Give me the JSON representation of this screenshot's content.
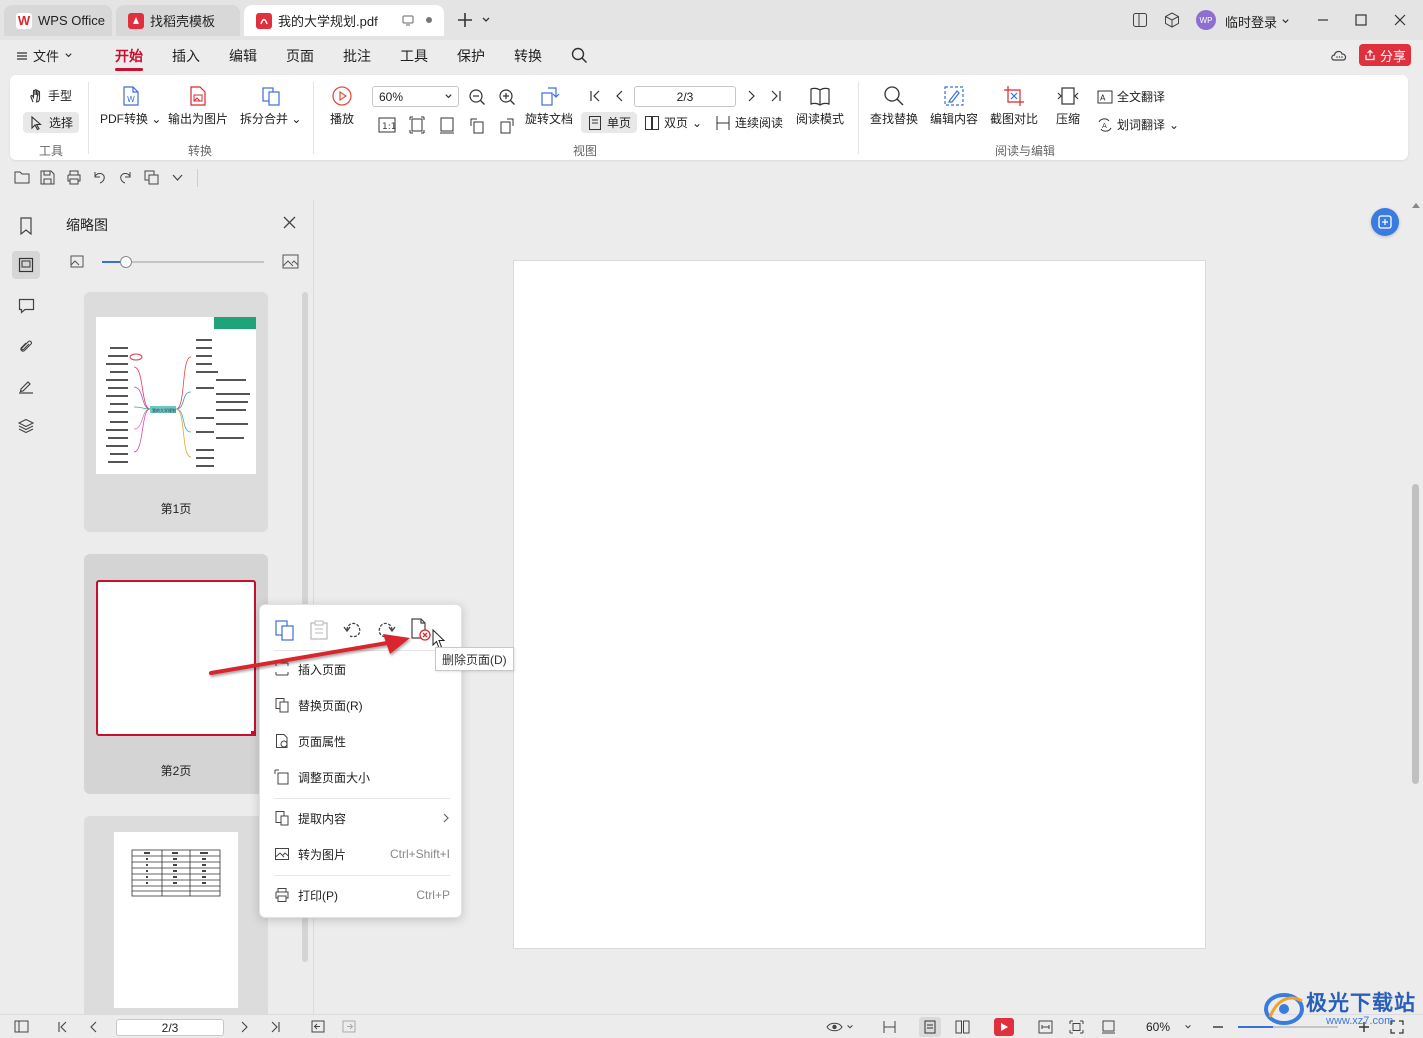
{
  "tabs": [
    {
      "label": "WPS Office"
    },
    {
      "label": "找稻壳模板"
    },
    {
      "label": "我的大学规划.pdf"
    }
  ],
  "titlebar": {
    "user_label": "临时登录",
    "avatar_text": "WP"
  },
  "menu": {
    "file_label": "文件",
    "items": [
      "开始",
      "插入",
      "编辑",
      "页面",
      "批注",
      "工具",
      "保护",
      "转换"
    ],
    "active": "开始",
    "share_label": "分享"
  },
  "ribbon": {
    "tools": {
      "hand": "手型",
      "select": "选择",
      "group": "工具"
    },
    "convert": {
      "pdf_convert": "PDF转换",
      "export_image": "输出为图片",
      "split_merge": "拆分合并",
      "group": "转换"
    },
    "view": {
      "play": "播放",
      "zoom": "60%",
      "page_input": "2/3",
      "rotate_doc": "旋转文档",
      "single_page": "单页",
      "double_page": "双页",
      "continuous": "连续阅读",
      "read_mode": "阅读模式",
      "group": "视图"
    },
    "edit": {
      "find_replace": "查找替换",
      "edit_content": "编辑内容",
      "screenshot_compare": "截图对比",
      "compress": "压缩",
      "full_translate": "全文翻译",
      "word_translate": "划词翻译",
      "group": "阅读与编辑"
    }
  },
  "thumbnails": {
    "title": "缩略图",
    "slider_fraction": 0.15,
    "pages": [
      {
        "label": "第1页",
        "mindmap_center": "我的大学规划"
      },
      {
        "label": "第2页"
      },
      {
        "label": ""
      }
    ]
  },
  "context_menu": {
    "items": [
      {
        "label": "插入页面",
        "shortcut": ""
      },
      {
        "label": "替换页面(R)",
        "shortcut": ""
      },
      {
        "label": "页面属性",
        "shortcut": ""
      },
      {
        "label": "调整页面大小",
        "shortcut": ""
      },
      {
        "label": "提取内容",
        "shortcut": ""
      },
      {
        "label": "转为图片",
        "shortcut": "Ctrl+Shift+I"
      },
      {
        "label": "打印(P)",
        "shortcut": "Ctrl+P"
      }
    ],
    "tooltip": "删除页面(D)"
  },
  "statusbar": {
    "page_input": "2/3",
    "zoom": "60%"
  },
  "watermark": {
    "text": "极光下载站",
    "url": "www.xz7.com"
  },
  "colors": {
    "accent": "#c8102e",
    "share": "#e0303e",
    "arrow": "#d9282f",
    "selected_border": "#c8102e"
  }
}
